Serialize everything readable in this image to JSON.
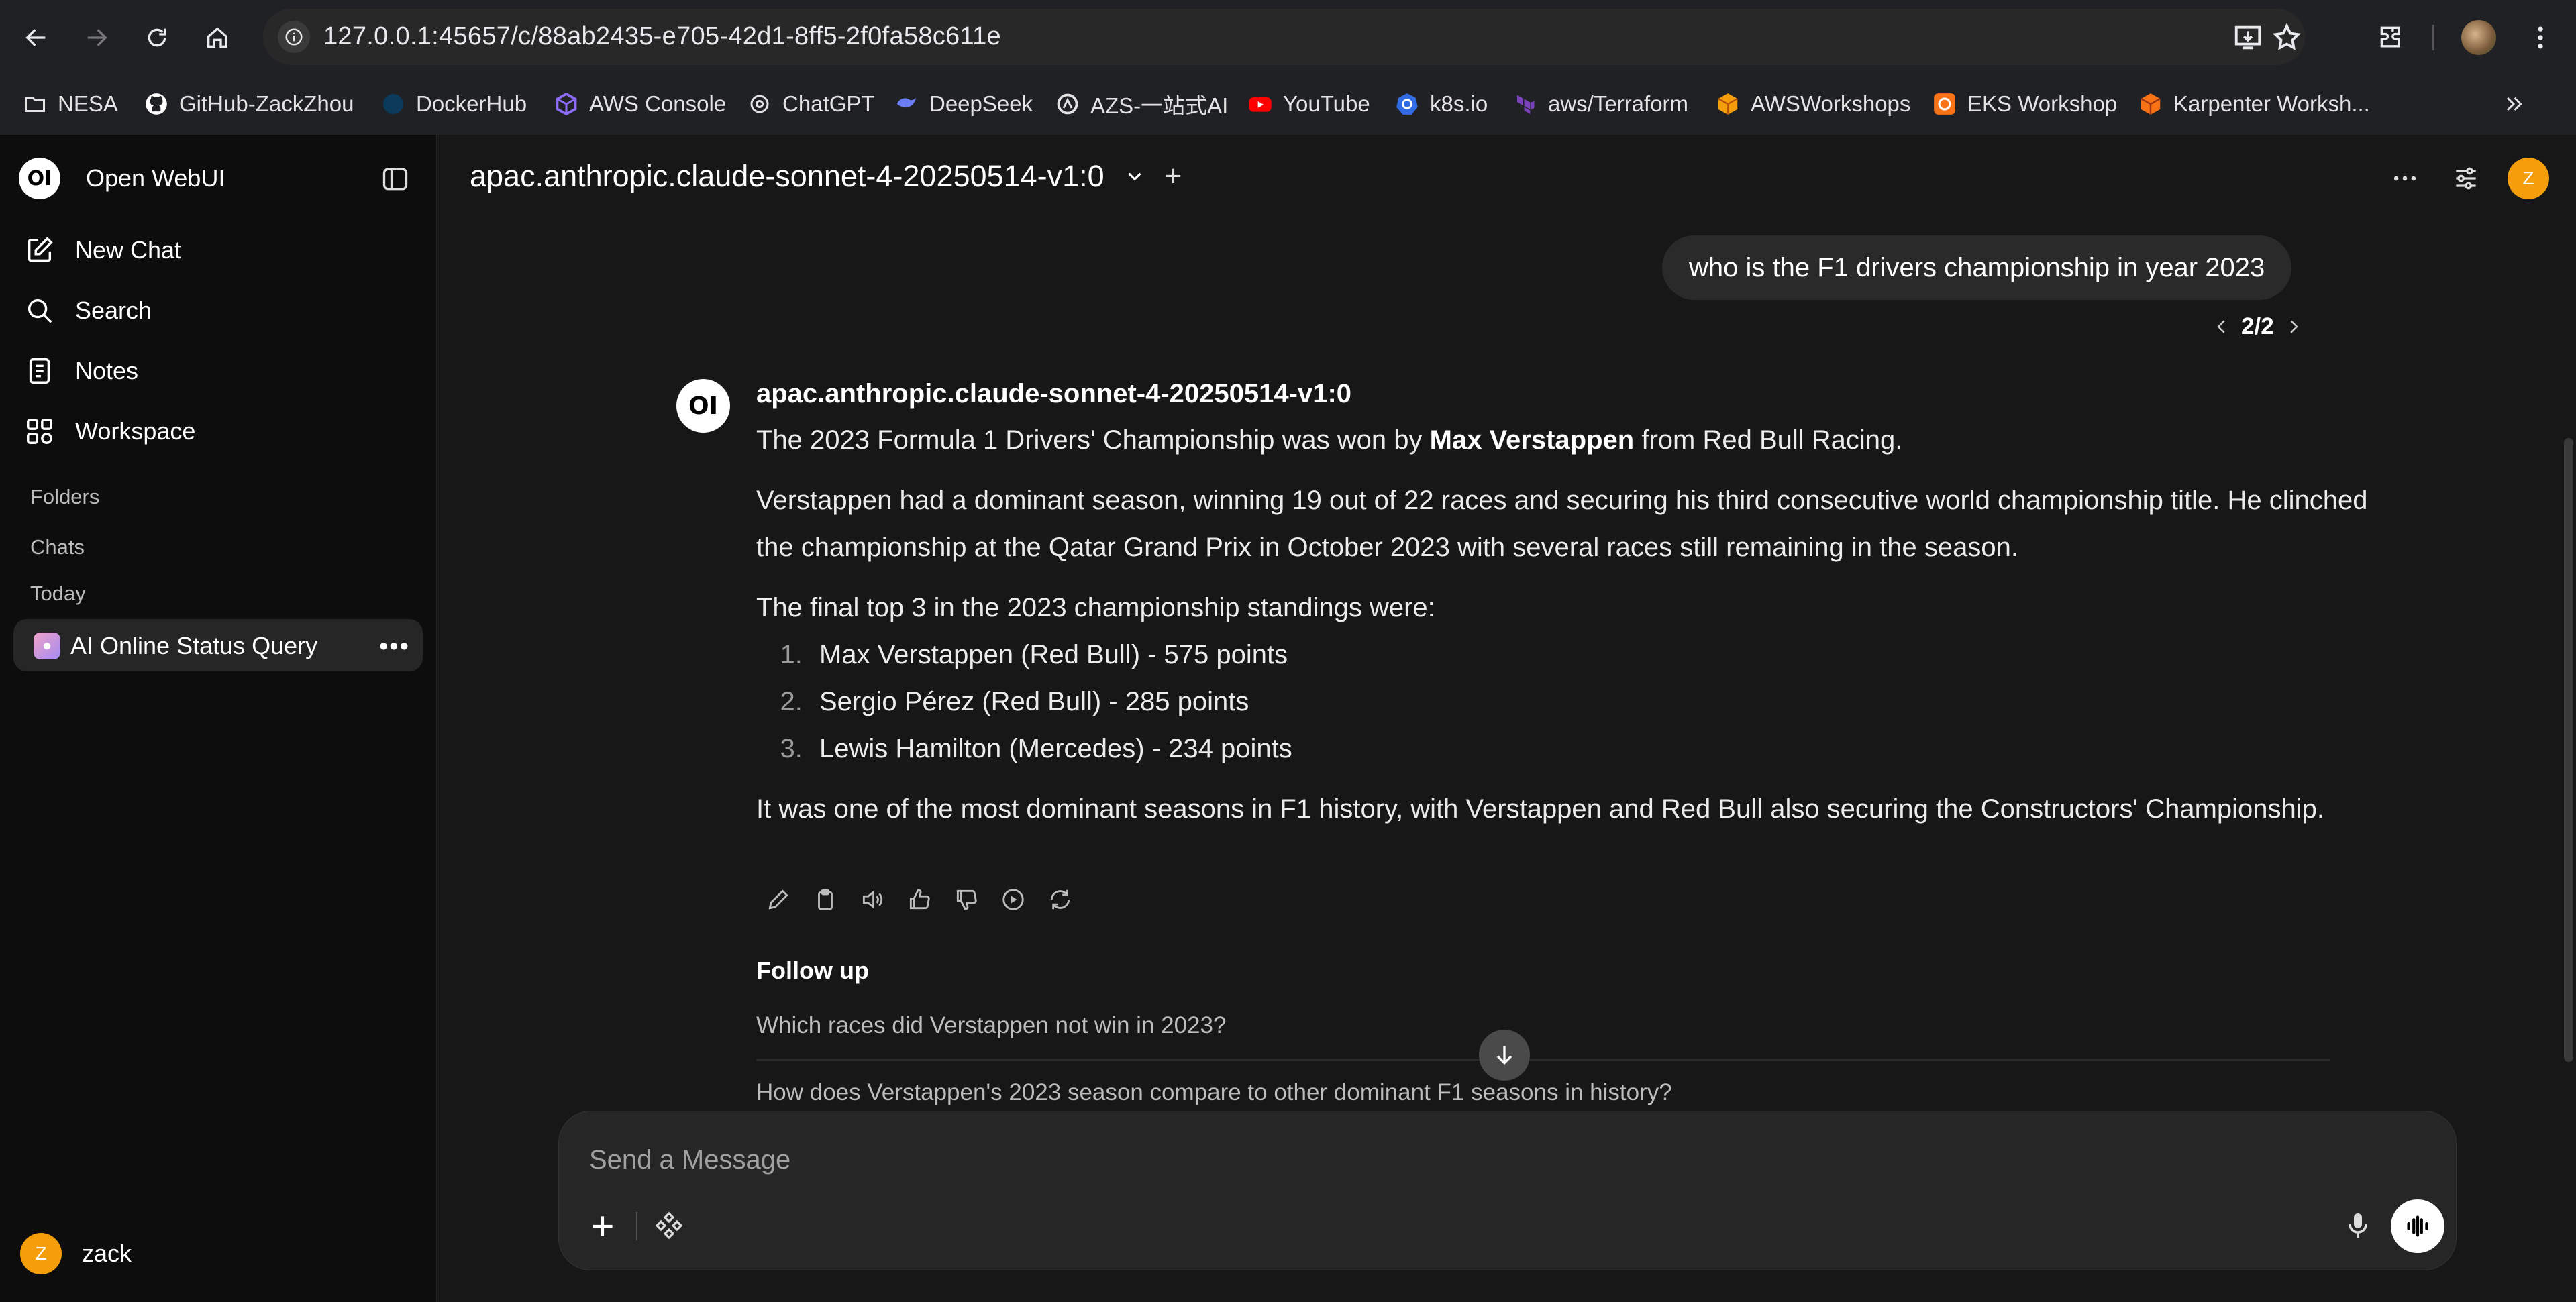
{
  "browser": {
    "url": "127.0.0.1:45657/c/88ab2435-e705-42d1-8ff5-2f0fa58c611e",
    "bookmarks": [
      {
        "label": "NESA",
        "icon": "folder-icon"
      },
      {
        "label": "GitHub-ZackZhou",
        "icon": "github-icon"
      },
      {
        "label": "DockerHub",
        "icon": "docker-icon"
      },
      {
        "label": "AWS Console",
        "icon": "aws-cube-icon"
      },
      {
        "label": "ChatGPT",
        "icon": "chatgpt-icon"
      },
      {
        "label": "DeepSeek",
        "icon": "deepseek-icon"
      },
      {
        "label": "AZS-一站式AI",
        "icon": "azs-icon"
      },
      {
        "label": "YouTube",
        "icon": "youtube-icon"
      },
      {
        "label": "k8s.io",
        "icon": "kubernetes-icon"
      },
      {
        "label": "aws/Terraform",
        "icon": "terraform-icon"
      },
      {
        "label": "AWSWorkshops",
        "icon": "aws-workshop-icon"
      },
      {
        "label": "EKS Workshop",
        "icon": "eks-icon"
      },
      {
        "label": "Karpenter Worksh...",
        "icon": "karpenter-icon"
      }
    ]
  },
  "sidebar": {
    "brand": "Open WebUI",
    "logo_text": "OI",
    "nav": [
      {
        "label": "New Chat",
        "icon": "pencil-square-icon"
      },
      {
        "label": "Search",
        "icon": "search-icon"
      },
      {
        "label": "Notes",
        "icon": "notes-icon"
      },
      {
        "label": "Workspace",
        "icon": "workspace-icon"
      }
    ],
    "sections": {
      "folders": "Folders",
      "chats": "Chats",
      "today": "Today"
    },
    "chat_item": {
      "title": "AI Online Status Query",
      "more": "•••"
    },
    "user": {
      "initial": "Z",
      "name": "zack"
    }
  },
  "header": {
    "model": "apac.anthropic.claude-sonnet-4-20250514-v1:0",
    "add": "+",
    "avatar_initial": "Z"
  },
  "conversation": {
    "user_message": "who is the F1 drivers championship in year 2023",
    "pager": "2/2",
    "bot_name": "apac.anthropic.claude-sonnet-4-20250514-v1:0",
    "p1_pre": "The 2023 Formula 1 Drivers' Championship was won by ",
    "p1_bold": "Max Verstappen",
    "p1_post": " from Red Bull Racing.",
    "p2": "Verstappen had a dominant season, winning 19 out of 22 races and securing his third consecutive world championship title. He clinched the championship at the Qatar Grand Prix in October 2023 with several races still remaining in the season.",
    "p3": "The final top 3 in the 2023 championship standings were:",
    "standings": [
      "Max Verstappen (Red Bull) - 575 points",
      "Sergio Pérez (Red Bull) - 285 points",
      "Lewis Hamilton (Mercedes) - 234 points"
    ],
    "p4": "It was one of the most dominant seasons in F1 history, with Verstappen and Red Bull also securing the Constructors' Championship.",
    "followup_heading": "Follow up",
    "followups": [
      "Which races did Verstappen not win in 2023?",
      "How does Verstappen's 2023 season compare to other dominant F1 seasons in history?"
    ]
  },
  "composer": {
    "placeholder": "Send a Message"
  },
  "colors": {
    "accent": "#f59e0b",
    "background": "#171717",
    "sidebar": "#0d0d0d"
  }
}
